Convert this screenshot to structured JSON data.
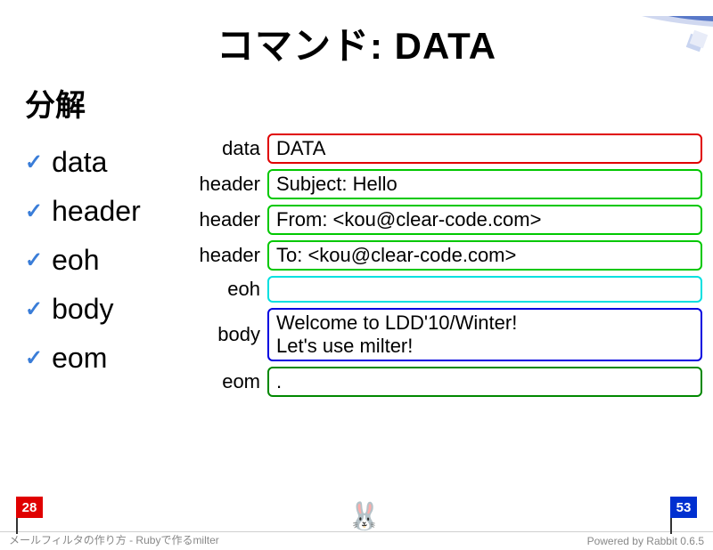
{
  "title": "コマンド: DATA",
  "subtitle": "分解",
  "list": {
    "items": [
      {
        "label": "data"
      },
      {
        "label": "header"
      },
      {
        "label": "eoh"
      },
      {
        "label": "body"
      },
      {
        "label": "eom"
      }
    ]
  },
  "diagram": {
    "rows": [
      {
        "label": "data",
        "content": "DATA",
        "color": "red"
      },
      {
        "label": "header",
        "content": "Subject: Hello",
        "color": "green"
      },
      {
        "label": "header",
        "content": "From: <kou@clear-code.com>",
        "color": "green"
      },
      {
        "label": "header",
        "content": "To: <kou@clear-code.com>",
        "color": "green"
      },
      {
        "label": "eoh",
        "content": "",
        "color": "cyan"
      },
      {
        "label": "body",
        "content": "Welcome to LDD'10/Winter!\nLet's use milter!",
        "color": "blue"
      },
      {
        "label": "eom",
        "content": ".",
        "color": "dgreen"
      }
    ]
  },
  "footer": {
    "current_page": "28",
    "total_pages": "53",
    "left_text": "メールフィルタの作り方 - Rubyで作るmilter",
    "right_text": "Powered by Rabbit 0.6.5"
  }
}
